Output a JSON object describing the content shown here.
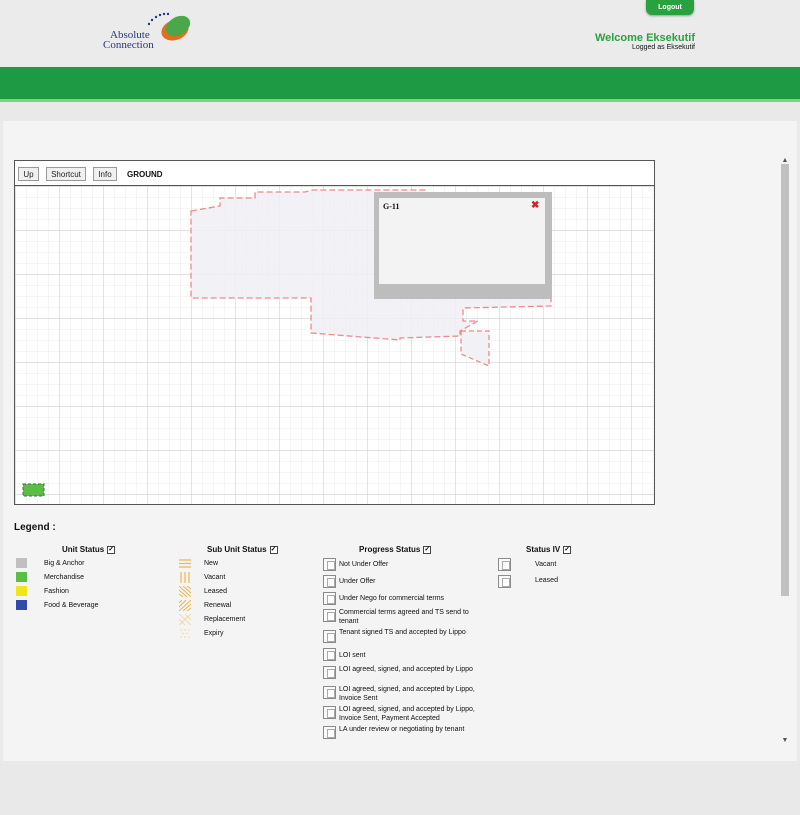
{
  "header": {
    "logo_line1": "Absolute",
    "logo_line2": "Connection",
    "logout_label": "Logout",
    "welcome_text": "Welcome Eksekutif",
    "logged_as_text": "Logged as Eksekutif"
  },
  "toolbar": {
    "up_label": "Up",
    "shortcut_label": "Shortcut",
    "info_label": "Info",
    "floor_label": "GROUND"
  },
  "popup": {
    "unit_title": "G-11",
    "close_symbol": "✖"
  },
  "legend": {
    "title": "Legend :",
    "unit_status": {
      "heading": "Unit Status",
      "items": [
        {
          "label": "Big & Anchor",
          "color": "#c0c0c0"
        },
        {
          "label": "Merchandise",
          "color": "#5bbd45"
        },
        {
          "label": "Fashion",
          "color": "#f0e61a"
        },
        {
          "label": "Food & Beverage",
          "color": "#2f4aa8"
        }
      ]
    },
    "sub_unit_status": {
      "heading": "Sub Unit Status",
      "items": [
        "New",
        "Vacant",
        "Leased",
        "Renewal",
        "Replacement",
        "Expiry"
      ]
    },
    "progress_status": {
      "heading": "Progress Status",
      "items": [
        "Not Under Offer",
        "Under Offer",
        "Under Nego for commercial terms",
        "Commercial terms agreed and TS send to tenant",
        "Tenant signed TS and accepted by Lippo",
        "LOI sent",
        "LOI agreed, signed, and accepted by Lippo",
        "LOI agreed, signed, and accepted by Lippo, Invoice Sent",
        "LOI agreed, signed, and accepted by Lippo, Invoice Sent, Payment Accepted",
        "LA under review or negotiating by tenant"
      ]
    },
    "status_iv": {
      "heading": "Status IV",
      "items": [
        "Vacant",
        "Leased"
      ]
    },
    "check_mark": "✓"
  },
  "colors": {
    "brand_green": "#1e9a44",
    "accent_light_green": "#7fd17f",
    "boundary_dash": "#f08a8a",
    "close_red": "#c62828"
  }
}
